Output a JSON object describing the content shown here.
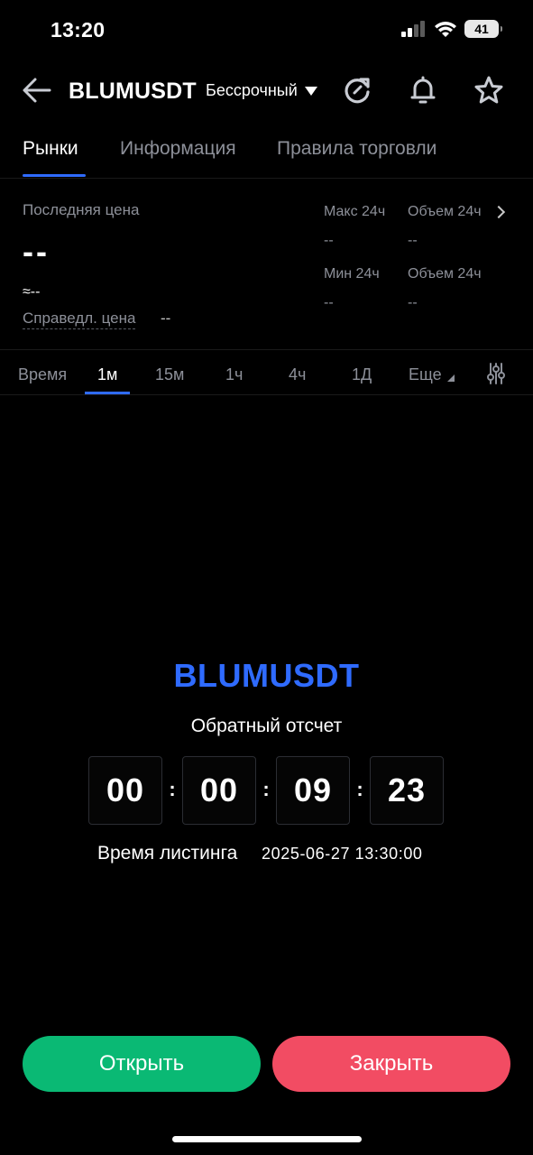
{
  "status_bar": {
    "time": "13:20",
    "battery": "41",
    "icons": [
      "signal-icon",
      "wifi-icon",
      "battery-icon"
    ]
  },
  "header": {
    "symbol": "BLUMUSDT",
    "contract_type": "Бессрочный",
    "icons": [
      "back-arrow-icon",
      "refresh-icon",
      "bell-icon",
      "star-icon"
    ]
  },
  "tabs": [
    {
      "label": "Рынки",
      "active": true
    },
    {
      "label": "Информация",
      "active": false
    },
    {
      "label": "Правила торговли",
      "active": false
    }
  ],
  "price": {
    "last_price_label": "Последняя цена",
    "last_price": "--",
    "approx": "≈--",
    "fair_price_label": "Справедл. цена",
    "fair_price": "--",
    "high_24h_label": "Макс 24ч",
    "high_24h": "--",
    "volume_24h_label": "Объем 24ч",
    "volume_24h": "--",
    "low_24h_label": "Мин 24ч",
    "low_24h": "--",
    "volume2_24h_label": "Объем 24ч",
    "volume2_24h": "--"
  },
  "intervals": {
    "items": [
      "Время",
      "1м",
      "15м",
      "1ч",
      "4ч",
      "1Д"
    ],
    "active": "1м",
    "more_label": "Еще"
  },
  "countdown": {
    "symbol": "BLUMUSDT",
    "label": "Обратный отсчет",
    "days": "00",
    "hours": "00",
    "minutes": "09",
    "seconds": "23",
    "separator": ":",
    "listing_label": "Время листинга",
    "listing_time": "2025-06-27 13:30:00"
  },
  "actions": {
    "open_label": "Открыть",
    "close_label": "Закрыть"
  },
  "colors": {
    "accent": "#2f6bff",
    "open": "#0ab974",
    "close": "#f24c63",
    "muted": "#8d9099",
    "background": "#000000"
  }
}
